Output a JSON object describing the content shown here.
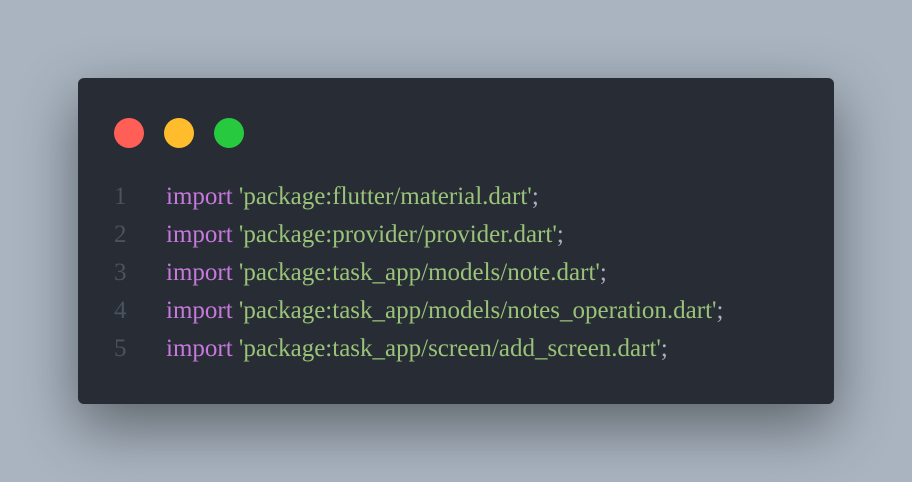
{
  "window": {
    "controls": [
      {
        "name": "close",
        "color": "#ff5f56"
      },
      {
        "name": "minimize",
        "color": "#ffbd2e"
      },
      {
        "name": "maximize",
        "color": "#27c93f"
      }
    ]
  },
  "code": {
    "colors": {
      "keyword": "#c678dd",
      "string": "#98c379",
      "punctuation": "#abb2bf",
      "line_number": "#4b5260",
      "background": "#282c34"
    },
    "lines": [
      {
        "number": "1",
        "keyword": "import",
        "string": "'package:flutter/material.dart'",
        "punct": ";"
      },
      {
        "number": "2",
        "keyword": "import",
        "string": "'package:provider/provider.dart'",
        "punct": ";"
      },
      {
        "number": "3",
        "keyword": "import",
        "string": "'package:task_app/models/note.dart'",
        "punct": ";"
      },
      {
        "number": "4",
        "keyword": "import",
        "string": "'package:task_app/models/notes_operation.dart'",
        "punct": ";"
      },
      {
        "number": "5",
        "keyword": "import",
        "string": "'package:task_app/screen/add_screen.dart'",
        "punct": ";"
      }
    ]
  }
}
